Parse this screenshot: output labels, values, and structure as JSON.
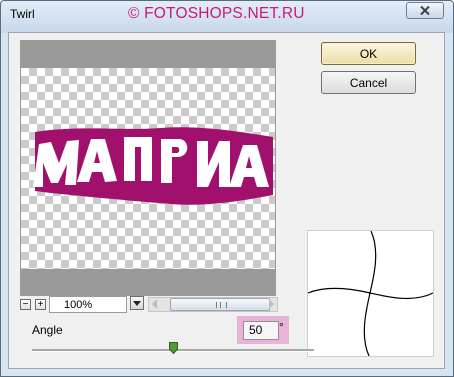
{
  "window": {
    "title": "Twirl"
  },
  "watermark": "© FOTOSHOPS.NET.RU",
  "preview": {
    "zoom": "100%",
    "zoom_out_label": "−",
    "zoom_in_label": "+"
  },
  "buttons": {
    "ok": "OK",
    "cancel": "Cancel"
  },
  "angle": {
    "label": "Angle",
    "value": "50",
    "unit": "°",
    "slider_fraction": 0.5
  },
  "colors": {
    "highlight": "#e7b3d6",
    "watermark": "#c8197d",
    "preview_text": "#a2106e"
  }
}
